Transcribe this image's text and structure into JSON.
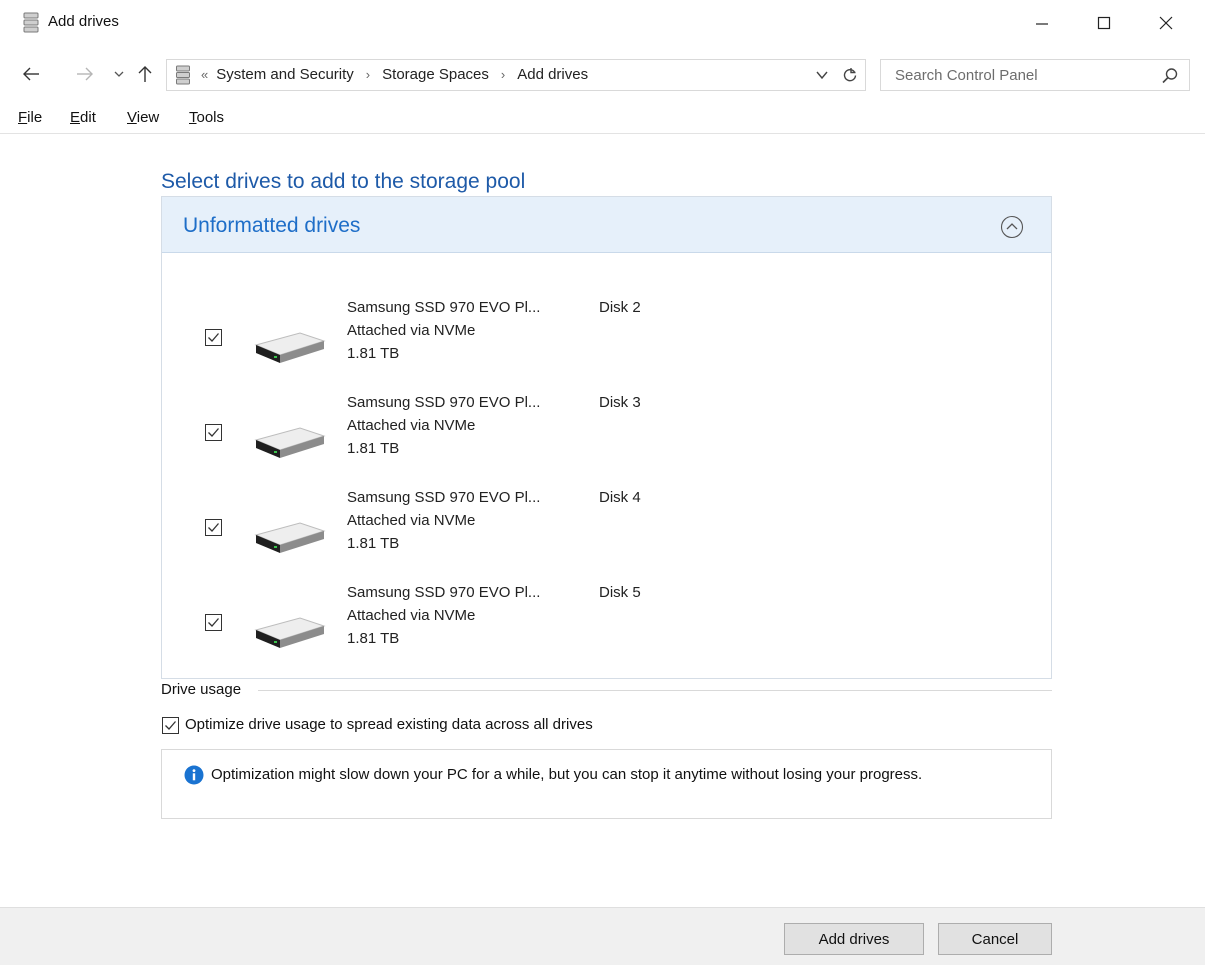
{
  "window": {
    "title": "Add drives",
    "icon": "storage-spaces-icon"
  },
  "address_bar": {
    "breadcrumbs": [
      "System and Security",
      "Storage Spaces",
      "Add drives"
    ],
    "search_placeholder": "Search Control Panel"
  },
  "menu": {
    "file": {
      "accel": "F",
      "rest": "ile"
    },
    "edit": {
      "accel": "E",
      "rest": "dit"
    },
    "view": {
      "accel": "V",
      "rest": "iew"
    },
    "tools": {
      "accel": "T",
      "rest": "ools"
    }
  },
  "main": {
    "heading": "Select drives to add to the storage pool",
    "panel_title": "Unformatted drives",
    "drives": [
      {
        "name": "Samsung SSD 970 EVO Pl...",
        "disk": "Disk 2",
        "connection": "Attached via NVMe",
        "size": "1.81 TB",
        "checked": true
      },
      {
        "name": "Samsung SSD 970 EVO Pl...",
        "disk": "Disk 3",
        "connection": "Attached via NVMe",
        "size": "1.81 TB",
        "checked": true
      },
      {
        "name": "Samsung SSD 970 EVO Pl...",
        "disk": "Disk 4",
        "connection": "Attached via NVMe",
        "size": "1.81 TB",
        "checked": true
      },
      {
        "name": "Samsung SSD 970 EVO Pl...",
        "disk": "Disk 5",
        "connection": "Attached via NVMe",
        "size": "1.81 TB",
        "checked": true
      }
    ]
  },
  "drive_usage": {
    "label": "Drive usage",
    "optimize_label": "Optimize drive usage to spread existing data across all drives",
    "optimize_checked": true,
    "info_text": "Optimization might slow down your PC for a while, but you can stop it anytime without losing your progress."
  },
  "buttons": {
    "add": "Add drives",
    "cancel": "Cancel"
  },
  "colors": {
    "heading": "#1e5aa8",
    "panel_header_bg": "#e6f0fa",
    "info_icon": "#1a73d1"
  }
}
